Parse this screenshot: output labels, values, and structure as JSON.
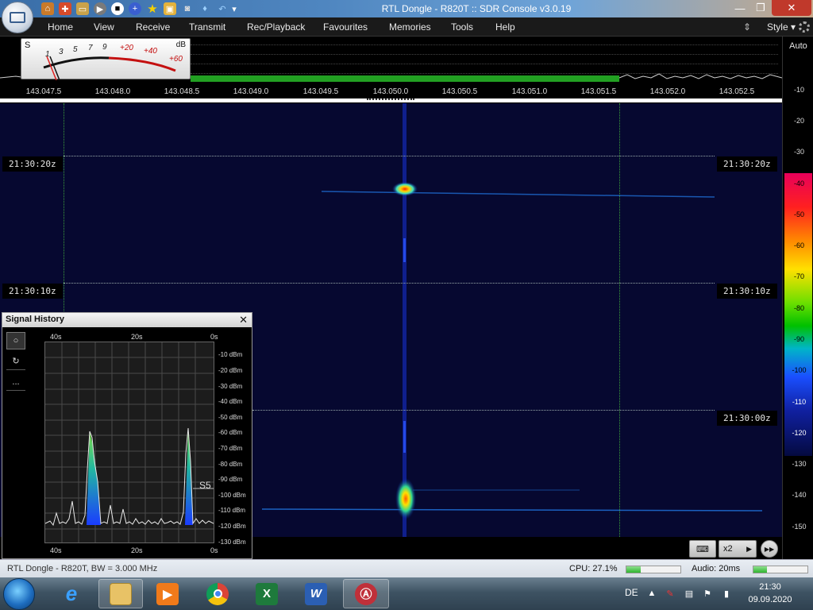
{
  "window": {
    "title": "RTL Dongle - R820T :: SDR Console v3.0.19",
    "minimize": "—",
    "restore": "❐",
    "close": "✕"
  },
  "menu": {
    "items": [
      "Home",
      "View",
      "Receive",
      "Transmit",
      "Rec/Playback",
      "Favourites",
      "Memories",
      "Tools",
      "Help"
    ],
    "style_label": "Style"
  },
  "smeter": {
    "s_label": "S",
    "db_label": "dB",
    "scale_black": [
      "1",
      "3",
      "5",
      "7",
      "9"
    ],
    "scale_red": [
      "+20",
      "+40",
      "+60"
    ]
  },
  "frequency_axis": {
    "labels": [
      "143.047.5",
      "143.048.0",
      "143.048.5",
      "143.049.0",
      "143.049.5",
      "143.050.0",
      "143.050.5",
      "143.051.0",
      "143.051.5",
      "143.052.0",
      "143.052.5"
    ]
  },
  "waterfall": {
    "time_tags": [
      "21:30:20z",
      "21:30:10z",
      "21:30:00z"
    ]
  },
  "db_scale": {
    "auto_label": "Auto",
    "ticks": [
      "-10",
      "-20",
      "-30",
      "-40",
      "-50",
      "-60",
      "-70",
      "-80",
      "-90",
      "-100",
      "-110",
      "-120",
      "-130",
      "-140",
      "-150"
    ]
  },
  "controls": {
    "keyboard_icon": "keyboard-icon",
    "zoom_label": "x2",
    "play_arrow": "▶",
    "step_icon": "▶▶"
  },
  "signal_history": {
    "title": "Signal History",
    "close": "✕",
    "tools": [
      "○",
      "↻",
      "..."
    ],
    "time_labels": [
      "40s",
      "20s",
      "0s"
    ],
    "db_labels": [
      "-10 dBm",
      "-20 dBm",
      "-30 dBm",
      "-40 dBm",
      "-50 dBm",
      "-60 dBm",
      "-70 dBm",
      "-80 dBm",
      "-90 dBm",
      "-100 dBm",
      "-110 dBm",
      "-120 dBm",
      "-130 dBm"
    ],
    "s_marker": "S5"
  },
  "status": {
    "text": "RTL Dongle - R820T, BW = 3.000 MHz",
    "cpu_label": "CPU: 27.1%",
    "cpu_level": 0.271,
    "audio_label": "Audio: 20ms",
    "audio_level": 0.25
  },
  "taskbar": {
    "apps": [
      "internet-explorer",
      "file-explorer",
      "media-player",
      "chrome",
      "excel",
      "word",
      "sdr-console"
    ],
    "excel_glyph": "X",
    "word_glyph": "W",
    "language": "DE",
    "time": "21:30",
    "date": "09.09.2020"
  }
}
